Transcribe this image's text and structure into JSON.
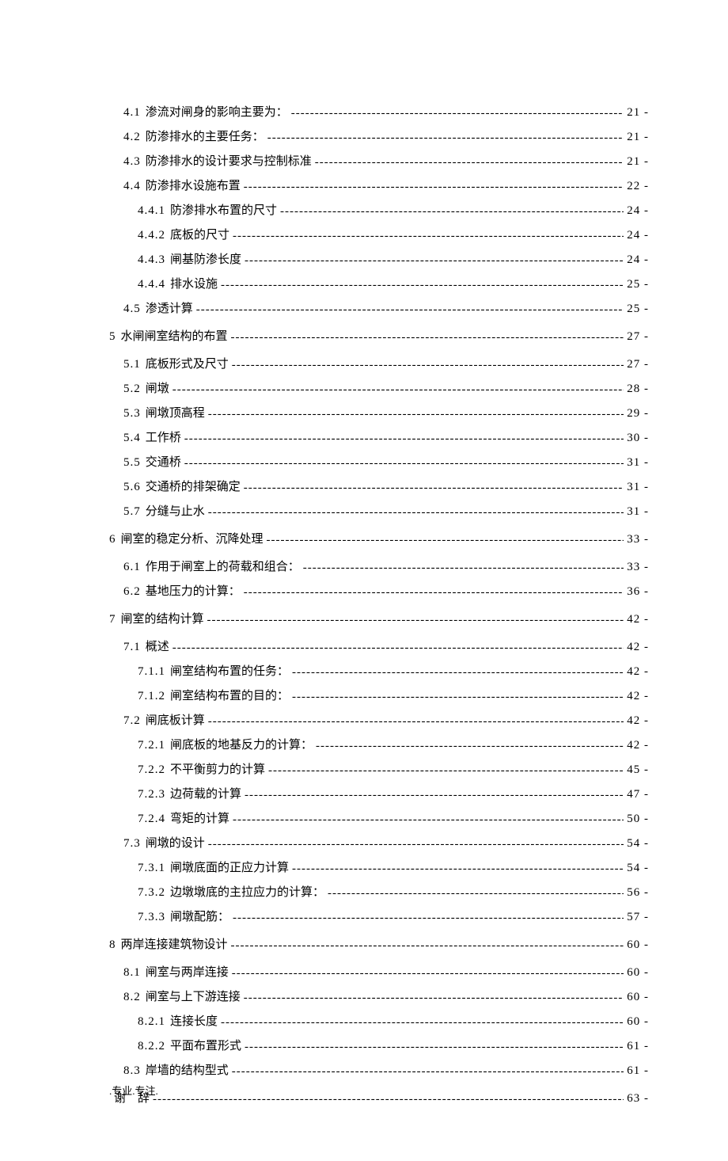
{
  "entries": [
    {
      "level": 2,
      "num": "4.1",
      "title": "渗流对闸身的影响主要为：",
      "page": "21 -"
    },
    {
      "level": 2,
      "num": "4.2",
      "title": "防渗排水的主要任务：",
      "page": "21 -"
    },
    {
      "level": 2,
      "num": "4.3",
      "title": "防渗排水的设计要求与控制标准",
      "page": "21 -"
    },
    {
      "level": 2,
      "num": "4.4",
      "title": "防渗排水设施布置",
      "page": "22 -"
    },
    {
      "level": 3,
      "num": "4.4.1",
      "title": "防渗排水布置的尺寸",
      "page": "24 -"
    },
    {
      "level": 3,
      "num": "4.4.2",
      "title": "底板的尺寸",
      "page": "24 -"
    },
    {
      "level": 3,
      "num": "4.4.3",
      "title": "闸基防渗长度",
      "page": "24 -"
    },
    {
      "level": 3,
      "num": "4.4.4",
      "title": "排水设施",
      "page": "25 -"
    },
    {
      "level": 2,
      "num": "4.5",
      "title": "渗透计算",
      "page": "25 -"
    },
    {
      "level": 1,
      "num": "5",
      "title": "水闸闸室结构的布置",
      "page": "27 -"
    },
    {
      "level": 2,
      "num": "5.1",
      "title": "底板形式及尺寸",
      "page": "27 -"
    },
    {
      "level": 2,
      "num": "5.2",
      "title": "闸墩",
      "page": "28 -"
    },
    {
      "level": 2,
      "num": "5.3",
      "title": "闸墩顶高程",
      "page": "29 -"
    },
    {
      "level": 2,
      "num": "5.4",
      "title": "工作桥",
      "page": "30 -"
    },
    {
      "level": 2,
      "num": "5.5",
      "title": "交通桥",
      "page": "31 -"
    },
    {
      "level": 2,
      "num": "5.6",
      "title": "交通桥的排架确定",
      "page": "31 -"
    },
    {
      "level": 2,
      "num": "5.7",
      "title": "分缝与止水",
      "page": "31 -"
    },
    {
      "level": 1,
      "num": "6",
      "title": "闸室的稳定分析、沉降处理",
      "page": "33 -"
    },
    {
      "level": 2,
      "num": "6.1",
      "title": "作用于闸室上的荷载和组合：",
      "page": "33 -"
    },
    {
      "level": 2,
      "num": "6.2",
      "title": "基地压力的计算：",
      "page": "36 -"
    },
    {
      "level": 1,
      "num": "7",
      "title": "闸室的结构计算",
      "page": "42 -"
    },
    {
      "level": 2,
      "num": "7.1",
      "title": "概述",
      "page": "42 -"
    },
    {
      "level": 3,
      "num": "7.1.1",
      "title": "闸室结构布置的任务：",
      "page": "42 -"
    },
    {
      "level": 3,
      "num": "7.1.2",
      "title": "闸室结构布置的目的：",
      "page": "42 -"
    },
    {
      "level": 2,
      "num": "7.2",
      "title": "闸底板计算",
      "page": "42 -"
    },
    {
      "level": 3,
      "num": "7.2.1",
      "title": "闸底板的地基反力的计算：",
      "page": "42 -"
    },
    {
      "level": 3,
      "num": "7.2.2",
      "title": "不平衡剪力的计算",
      "page": "45 -"
    },
    {
      "level": 3,
      "num": "7.2.3",
      "title": "边荷载的计算",
      "page": "47 -"
    },
    {
      "level": 3,
      "num": "7.2.4",
      "title": "弯矩的计算",
      "page": "50 -"
    },
    {
      "level": 2,
      "num": "7.3",
      "title": "闸墩的设计",
      "page": "54 -"
    },
    {
      "level": 3,
      "num": "7.3.1",
      "title": "闸墩底面的正应力计算",
      "page": "54 -"
    },
    {
      "level": 3,
      "num": "7.3.2",
      "title": "边墩墩底的主拉应力的计算：",
      "page": "56 -"
    },
    {
      "level": 3,
      "num": "7.3.3",
      "title": "闸墩配筋：",
      "page": "57 -"
    },
    {
      "level": 1,
      "num": "8",
      "title": "两岸连接建筑物设计",
      "page": "60 -"
    },
    {
      "level": 2,
      "num": "8.1",
      "title": "闸室与两岸连接",
      "page": "60 -"
    },
    {
      "level": 2,
      "num": "8.2",
      "title": "闸室与上下游连接",
      "page": "60 -"
    },
    {
      "level": 3,
      "num": "8.2.1",
      "title": "连接长度",
      "page": "60 -"
    },
    {
      "level": 3,
      "num": "8.2.2",
      "title": "平面布置形式",
      "page": "61 -"
    },
    {
      "level": 2,
      "num": "8.3",
      "title": "岸墙的结构型式",
      "page": "61 -"
    },
    {
      "level": 0,
      "num": "",
      "title": "谢　辞",
      "page": "63 -"
    }
  ],
  "footer": ".专业.专注."
}
